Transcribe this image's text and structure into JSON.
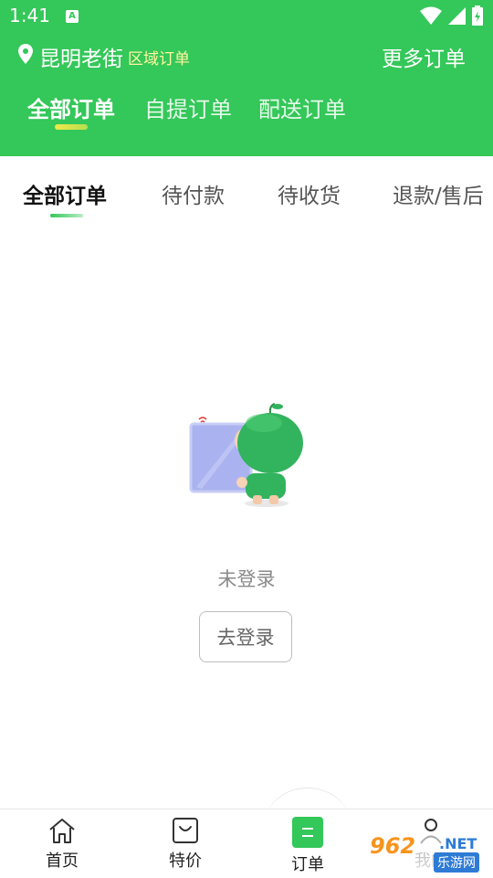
{
  "status_bar": {
    "time": "1:41",
    "notification_icon": "A"
  },
  "header": {
    "city": "昆明老街",
    "region_link": "区域订单",
    "more_orders": "更多订单",
    "tabs": [
      {
        "label": "全部订单",
        "active": true
      },
      {
        "label": "自提订单",
        "active": false
      },
      {
        "label": "配送订单",
        "active": false
      }
    ]
  },
  "sub_tabs": [
    {
      "label": "全部订单",
      "active": true
    },
    {
      "label": "待付款",
      "active": false
    },
    {
      "label": "待收货",
      "active": false
    },
    {
      "label": "退款/售后",
      "active": false
    }
  ],
  "empty_state": {
    "message": "未登录",
    "button": "去登录"
  },
  "bottom_nav": [
    {
      "label": "首页",
      "icon": "home-icon",
      "active": false
    },
    {
      "label": "特价",
      "icon": "bag-icon",
      "active": false
    },
    {
      "label": "订单",
      "icon": "order-list-icon",
      "active": true
    },
    {
      "label": "我的",
      "icon": "user-icon",
      "active": false
    }
  ],
  "watermark": {
    "number": "962",
    "suffix": ".NET",
    "site": "乐游网"
  },
  "colors": {
    "primary": "#34c759",
    "region_link": "#fff59d",
    "watermark_orange": "#f7941d",
    "watermark_blue": "#2e7bd6"
  }
}
